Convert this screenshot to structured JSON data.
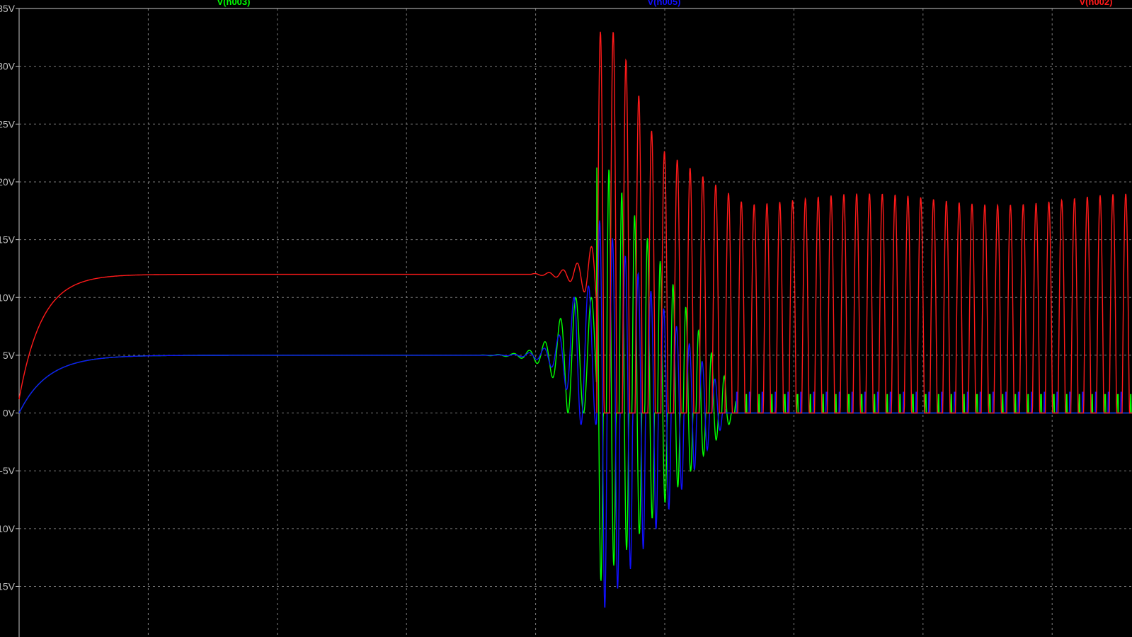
{
  "chart_data": {
    "type": "line",
    "title": "",
    "xlabel": "",
    "ylabel": "",
    "ylim": [
      -18,
      35
    ],
    "yticks": [
      {
        "v": 35,
        "label": "35V"
      },
      {
        "v": 30,
        "label": "30V"
      },
      {
        "v": 25,
        "label": "25V"
      },
      {
        "v": 20,
        "label": "20V"
      },
      {
        "v": 15,
        "label": "15V"
      },
      {
        "v": 10,
        "label": "10V"
      },
      {
        "v": 5,
        "label": "5V"
      },
      {
        "v": 0,
        "label": "0V"
      },
      {
        "v": -5,
        "label": "-5V"
      },
      {
        "v": -10,
        "label": "-10V"
      },
      {
        "v": -15,
        "label": "-15V"
      }
    ],
    "grid": true,
    "colors": {
      "background": "#000000",
      "grid": "#7a7a7a",
      "axis": "#c8c8c8",
      "tick_text": "#bfbfbf"
    },
    "legend_position": "top",
    "series": [
      {
        "name": "V(n003)",
        "color": "#00ff00",
        "legend_pos": "left"
      },
      {
        "name": "V(n005)",
        "color": "#1010ff",
        "legend_pos": "center"
      },
      {
        "name": "V(n002)",
        "color": "#ff1a1a",
        "legend_pos": "right"
      }
    ]
  }
}
